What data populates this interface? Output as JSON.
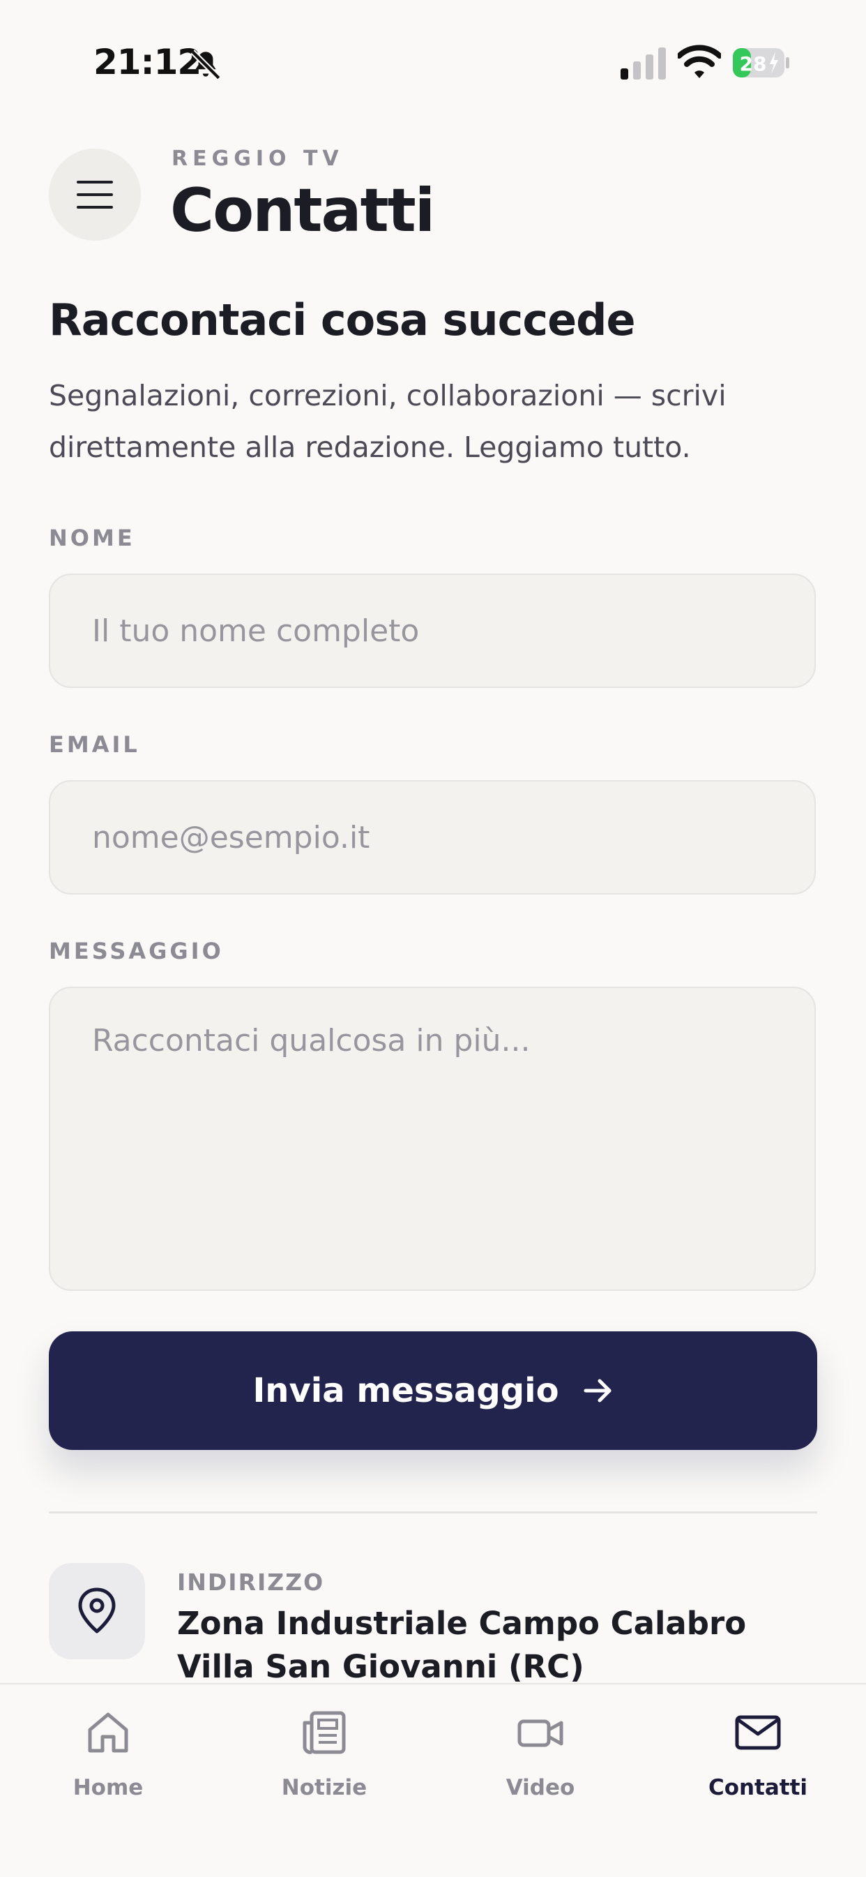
{
  "status_bar": {
    "time": "21:12",
    "battery": "28",
    "icons": [
      "bell-slash-icon",
      "signal-icon",
      "wifi-icon",
      "battery-icon"
    ]
  },
  "header": {
    "brand": "REGGIO TV",
    "title": "Contatti",
    "menu_icon": "hamburger-menu-icon"
  },
  "intro": {
    "title": "Raccontaci cosa succede",
    "description": "Segnalazioni, correzioni, collaborazioni — scrivi direttamente alla redazione. Leggiamo tutto."
  },
  "form": {
    "name": {
      "label": "NOME",
      "placeholder": "Il tuo nome completo",
      "value": ""
    },
    "email": {
      "label": "EMAIL",
      "placeholder": "nome@esempio.it",
      "value": ""
    },
    "message": {
      "label": "MESSAGGIO",
      "placeholder": "Raccontaci qualcosa in più...",
      "value": ""
    },
    "submit_label": "Invia messaggio",
    "submit_icon": "arrow-right-icon"
  },
  "address": {
    "icon": "map-pin-icon",
    "label": "INDIRIZZO",
    "line1": "Zona Industriale Campo Calabro",
    "line2": "Villa San Giovanni (RC)"
  },
  "tabs": [
    {
      "label": "Home",
      "icon": "home-icon",
      "active": false
    },
    {
      "label": "Notizie",
      "icon": "newspaper-icon",
      "active": false
    },
    {
      "label": "Video",
      "icon": "video-camera-icon",
      "active": false
    },
    {
      "label": "Contatti",
      "icon": "mail-icon",
      "active": true
    }
  ],
  "colors": {
    "background": "#faf9f7",
    "primary": "#22244d",
    "text": "#1c1c24",
    "muted": "#8c8b93",
    "battery_green": "#34c759"
  }
}
